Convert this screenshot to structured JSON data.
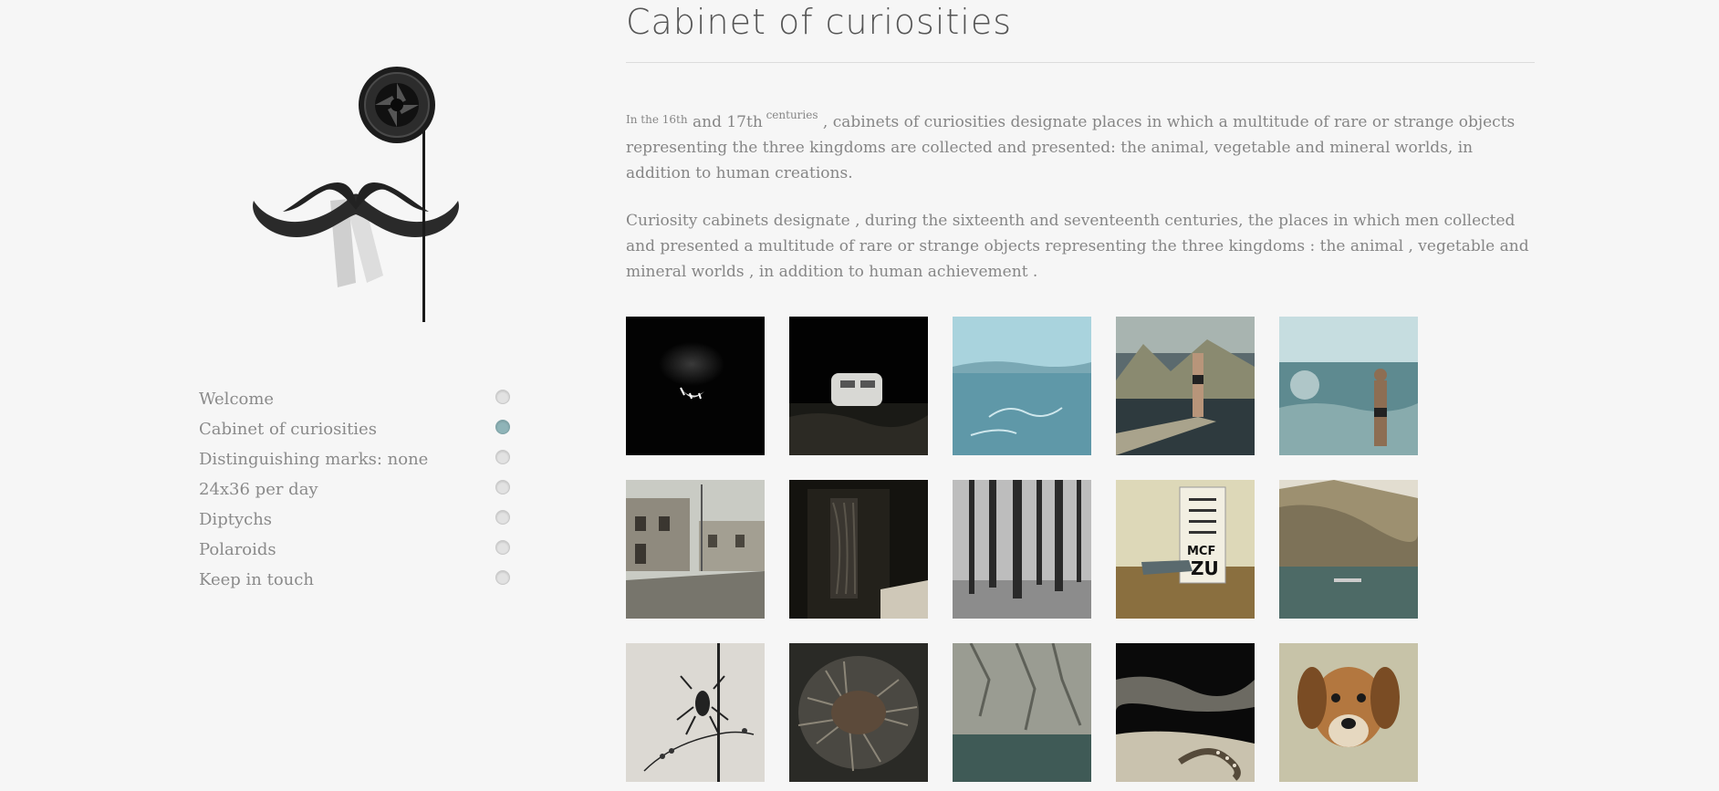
{
  "page": {
    "title": "Cabinet of curiosities",
    "intro": {
      "prefix": "In the 16th",
      "mid": " and 17th",
      "sup": " centuries",
      "rest": " , cabinets of curiosities designate places in which a multitude of rare or strange objects representing the three kingdoms are collected and presented: the animal, vegetable and mineral worlds, in addition to human creations."
    },
    "paragraph2": " Curiosity cabinets designate , during the sixteenth and seventeenth centuries, the places in which men collected and presented a multitude of rare or strange objects representing the three kingdoms : the animal , vegetable and mineral worlds , in addition to human achievement ."
  },
  "nav": {
    "items": [
      {
        "label": "Welcome",
        "active": false
      },
      {
        "label": "Cabinet of curiosities",
        "active": true
      },
      {
        "label": "Distinguishing marks: none",
        "active": false
      },
      {
        "label": "24x36 per day",
        "active": false
      },
      {
        "label": "Diptychs",
        "active": false
      },
      {
        "label": "Polaroids",
        "active": false
      },
      {
        "label": "Keep in touch",
        "active": false
      }
    ]
  },
  "colors": {
    "background": "#f6f6f6",
    "active_dot": "#8fb4b8",
    "text": "#888888"
  },
  "gallery": {
    "photos": [
      {
        "name": "dog-snarl-photo",
        "icon": "dark-animal-teeth"
      },
      {
        "name": "caravan-night-photo",
        "icon": "white-caravan"
      },
      {
        "name": "blue-sea-photo",
        "icon": "seascape"
      },
      {
        "name": "man-on-pier-photo",
        "icon": "man-on-pier"
      },
      {
        "name": "man-in-water-photo",
        "icon": "man-wading"
      },
      {
        "name": "village-street-photo",
        "icon": "old-houses"
      },
      {
        "name": "dark-wardrobe-photo",
        "icon": "wardrobe"
      },
      {
        "name": "bare-forest-photo",
        "icon": "tree-trunks"
      },
      {
        "name": "eye-chart-desk-photo",
        "icon": "eye-chart"
      },
      {
        "name": "mountain-lake-photo",
        "icon": "mountain-lake"
      },
      {
        "name": "insect-on-stem-photo",
        "icon": "insect"
      },
      {
        "name": "nest-twigs-photo",
        "icon": "nest"
      },
      {
        "name": "rock-cliff-water-photo",
        "icon": "rock-cliff"
      },
      {
        "name": "octopus-rocks-photo",
        "icon": "tentacle"
      },
      {
        "name": "dog-portrait-photo",
        "icon": "dog"
      }
    ],
    "eye_chart_letters": [
      "MCF",
      "ZU"
    ]
  }
}
